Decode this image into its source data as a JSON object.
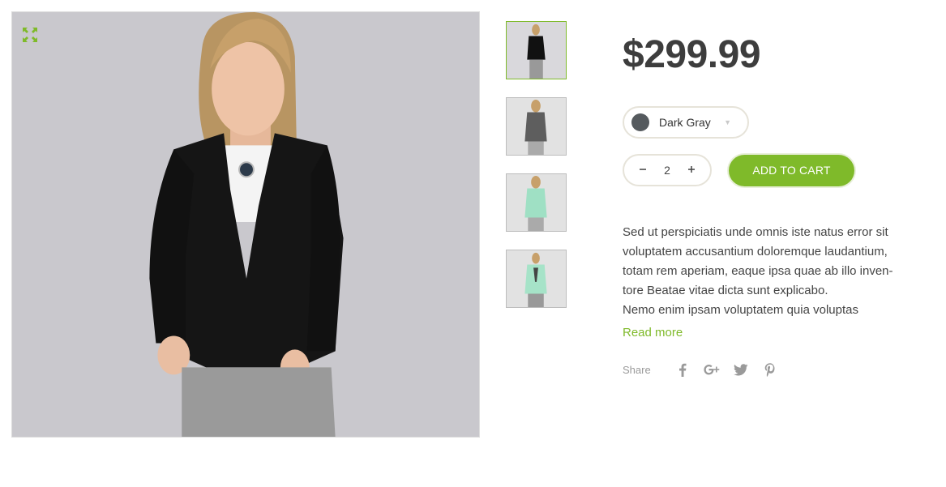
{
  "product": {
    "price": "$299.99",
    "color": {
      "selected": "Dark Gray",
      "swatch_color": "#555a5e"
    },
    "quantity": "2",
    "add_to_cart_label": "ADD TO CART",
    "description_lines": [
      "Sed ut perspiciatis unde omnis iste natus error sit",
      "voluptatem accusantium doloremque laudantium,",
      "totam rem aperiam, eaque ipsa quae ab illo inven-",
      "tore Beatae vitae dicta sunt explicabo.",
      "Nemo enim ipsam voluptatem quia voluptas"
    ],
    "read_more_label": "Read more",
    "share_label": "Share"
  },
  "icons": {
    "expand": "expand-icon",
    "minus": "minus-icon",
    "plus": "plus-icon",
    "dropdown": "chevron-down-icon",
    "social": [
      "facebook-icon",
      "google-plus-icon",
      "twitter-icon",
      "pinterest-icon"
    ]
  },
  "colors": {
    "accent": "#7fba2a",
    "price": "#3d3d3d",
    "border": "#e6e3d9"
  }
}
